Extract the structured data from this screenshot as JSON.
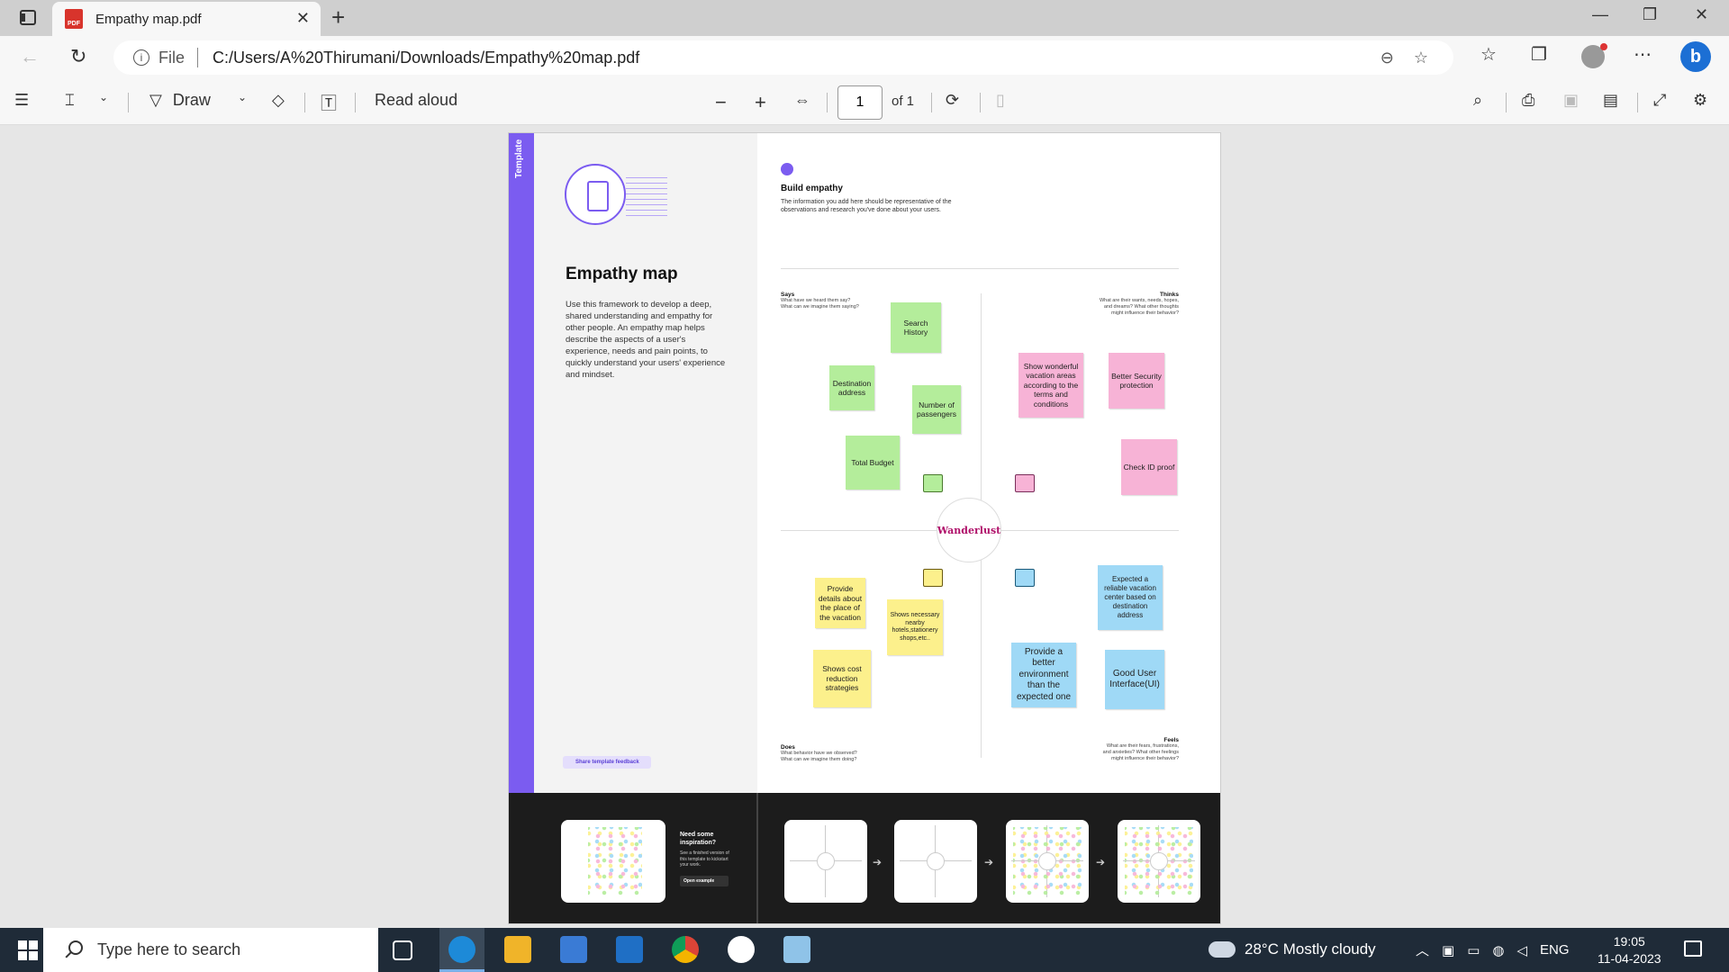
{
  "browser": {
    "tab_title": "Empathy map.pdf",
    "tab_close": "✕",
    "new_tab": "+",
    "address_prefix": "File",
    "url": "C:/Users/A%20Thirumani/Downloads/Empathy%20map.pdf",
    "window_minimize": "—",
    "window_restore": "❐",
    "window_close": "✕"
  },
  "pdf_toolbar": {
    "draw_label": "Draw",
    "read_aloud_label": "Read aloud",
    "zoom_out": "−",
    "zoom_in": "+",
    "page_number": "1",
    "page_total": "of 1"
  },
  "template": {
    "side_tag": "Template",
    "title": "Empathy map",
    "description": "Use this framework to develop a deep, shared understanding and empathy for other people. An empathy map helps describe the aspects of a user's experience, needs and pain points, to quickly understand your users' experience and mindset.",
    "feedback_label": "Share template feedback",
    "inspiration_title": "Need some inspiration?",
    "inspiration_text": "See a finished version of this template to kickstart your work.",
    "open_example_label": "Open example"
  },
  "empathy": {
    "build_title": "Build empathy",
    "build_desc": "The information you add here should be representative of the observations and research you've done about your users.",
    "center_label": "Wanderlust",
    "says": {
      "title": "Says",
      "desc": "What have we heard them say? What can we imagine them saying?"
    },
    "thinks": {
      "title": "Thinks",
      "desc": "What are their wants, needs, hopes, and dreams? What other thoughts might influence their behavior?"
    },
    "does": {
      "title": "Does",
      "desc": "What behavior have we observed? What can we imagine them doing?"
    },
    "feels": {
      "title": "Feels",
      "desc": "What are their fears, frustrations, and anxieties? What other feelings might influence their behavior?"
    },
    "notes_says": [
      "Search History",
      "Destination address",
      "Number of passengers",
      "Total Budget"
    ],
    "notes_thinks": [
      "Show wonderful vacation areas according to the terms and conditions",
      "Better Security protection",
      "Check ID proof"
    ],
    "notes_does": [
      "Provide details about the place of the vacation",
      "Shows necessary nearby hotels,stationery shops,etc..",
      "Shows cost reduction strategies"
    ],
    "notes_feels": [
      "Expected a reliable vacation center based on destination address",
      "Provide a better environment than the expected one",
      "Good User Interface(UI)"
    ]
  },
  "taskbar": {
    "search_placeholder": "Type here to search",
    "weather": "28°C  Mostly cloudy",
    "language": "ENG",
    "time": "19:05",
    "date": "11-04-2023"
  },
  "colors": {
    "accent_purple": "#7b5cf0",
    "center_text": "#b0116a",
    "note_green": "#b4ed9b",
    "note_pink": "#f7b3d6",
    "note_yellow": "#fcf08c",
    "note_blue": "#9fd9f6"
  }
}
